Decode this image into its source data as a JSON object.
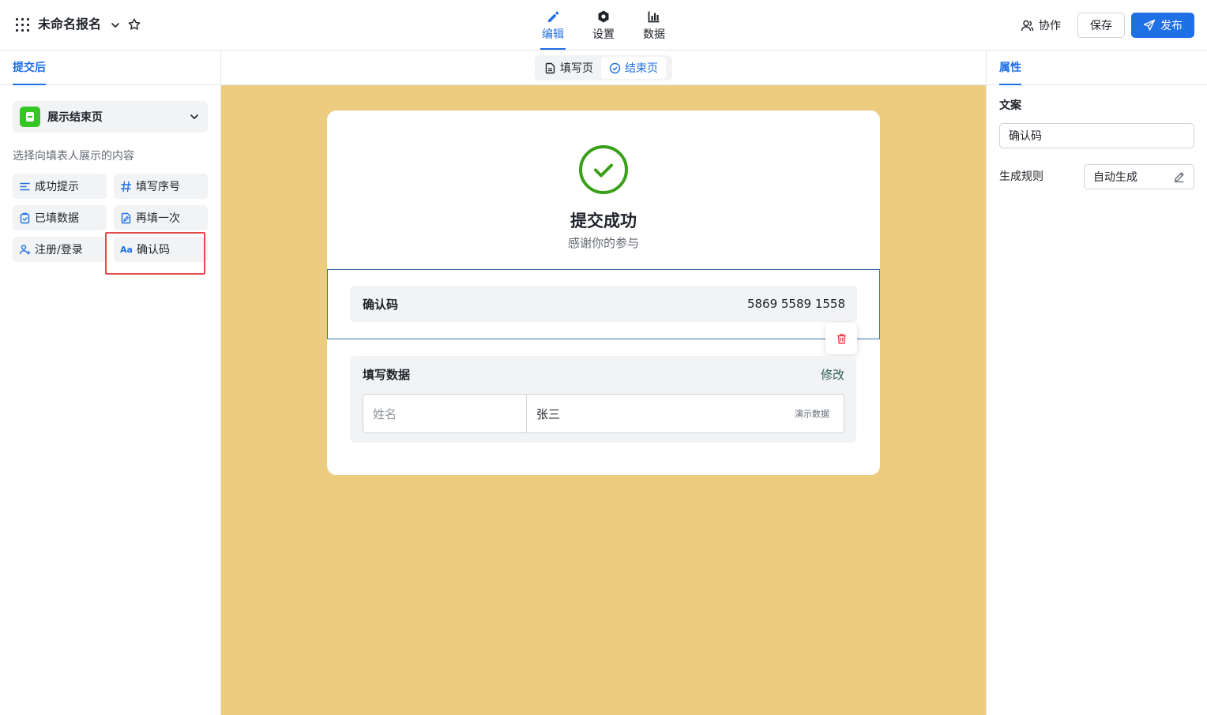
{
  "app": {
    "title": "未命名报名"
  },
  "nav": {
    "tabs": [
      {
        "label": "编辑",
        "icon": "pencil-icon",
        "active": true
      },
      {
        "label": "设置",
        "icon": "gear-icon",
        "active": false
      },
      {
        "label": "数据",
        "icon": "bar-chart-icon",
        "active": false
      }
    ]
  },
  "actions": {
    "collab_label": "协作",
    "save_label": "保存",
    "publish_label": "发布"
  },
  "left_panel": {
    "tab_label": "提交后",
    "display_select": "展示结束页",
    "hint": "选择向填表人展示的内容",
    "chips": [
      {
        "label": "成功提示",
        "icon": "lines-icon"
      },
      {
        "label": "填写序号",
        "icon": "hash-icon"
      },
      {
        "label": "已填数据",
        "icon": "clipboard-icon"
      },
      {
        "label": "再填一次",
        "icon": "edit-doc-icon"
      },
      {
        "label": "注册/登录",
        "icon": "user-plus-icon"
      },
      {
        "label": "确认码",
        "icon": "text-aa-icon",
        "icon_text": "Aa"
      }
    ]
  },
  "center": {
    "segments": [
      {
        "label": "填写页",
        "icon": "doc-icon",
        "active": false
      },
      {
        "label": "结束页",
        "icon": "check-circle-icon",
        "active": true
      }
    ],
    "success_title": "提交成功",
    "success_subtitle": "感谢你的参与",
    "confirm": {
      "label": "确认码",
      "value": "5869 5589 1558"
    },
    "filled_data": {
      "title": "填写数据",
      "edit_label": "修改",
      "rows": [
        {
          "key": "姓名",
          "value": "张三",
          "tag": "演示数据"
        }
      ]
    }
  },
  "right_panel": {
    "tab_label": "属性",
    "copy_label": "文案",
    "copy_value": "确认码",
    "rule_label": "生成规则",
    "rule_value": "自动生成"
  },
  "colors": {
    "accent": "#1f6fe5",
    "canvas_bg": "#eccd80",
    "success_green": "#3aa01a",
    "highlight_red": "#e5484d",
    "delete_red": "#e5484d"
  }
}
